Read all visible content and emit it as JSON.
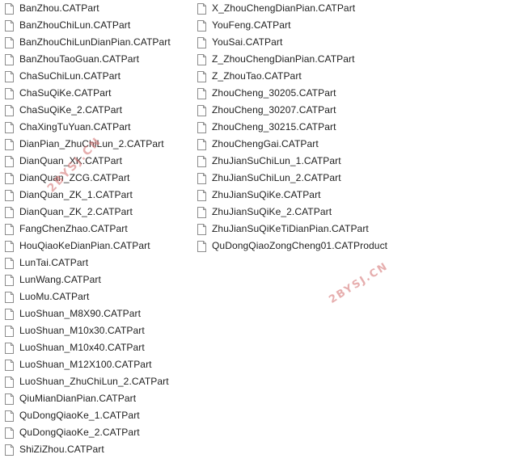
{
  "icon": "file-icon",
  "files_left": [
    "BanZhou.CATPart",
    "BanZhouChiLun.CATPart",
    "BanZhouChiLunDianPian.CATPart",
    "BanZhouTaoGuan.CATPart",
    "ChaSuChiLun.CATPart",
    "ChaSuQiKe.CATPart",
    "ChaSuQiKe_2.CATPart",
    "ChaXingTuYuan.CATPart",
    "DianPian_ZhuChiLun_2.CATPart",
    "DianQuan_XK.CATPart",
    "DianQuan_ZCG.CATPart",
    "DianQuan_ZK_1.CATPart",
    "DianQuan_ZK_2.CATPart",
    "FangChenZhao.CATPart",
    "HouQiaoKeDianPian.CATPart",
    "LunTai.CATPart",
    "LunWang.CATPart",
    "LuoMu.CATPart",
    "LuoShuan_M8X90.CATPart",
    "LuoShuan_M10x30.CATPart",
    "LuoShuan_M10x40.CATPart",
    "LuoShuan_M12X100.CATPart",
    "LuoShuan_ZhuChiLun_2.CATPart",
    "QiuMianDianPian.CATPart",
    "QuDongQiaoKe_1.CATPart",
    "QuDongQiaoKe_2.CATPart",
    "ShiZiZhou.CATPart"
  ],
  "files_right": [
    "X_ZhouChengDianPian.CATPart",
    "YouFeng.CATPart",
    "YouSai.CATPart",
    "Z_ZhouChengDianPian.CATPart",
    "Z_ZhouTao.CATPart",
    "ZhouCheng_30205.CATPart",
    "ZhouCheng_30207.CATPart",
    "ZhouCheng_30215.CATPart",
    "ZhouChengGai.CATPart",
    "ZhuJianSuChiLun_1.CATPart",
    "ZhuJianSuChiLun_2.CATPart",
    "ZhuJianSuQiKe.CATPart",
    "ZhuJianSuQiKe_2.CATPart",
    "ZhuJianSuQiKeTiDianPian.CATPart",
    "QuDongQiaoZongCheng01.CATProduct"
  ],
  "watermarks": [
    "2BYSJ.CN",
    "2BYSJ.CN"
  ],
  "colors": {
    "text": "#1e1e1e",
    "icon_stroke": "#8c8c8c",
    "icon_fill": "#ffffff",
    "watermark": "#d67878"
  }
}
